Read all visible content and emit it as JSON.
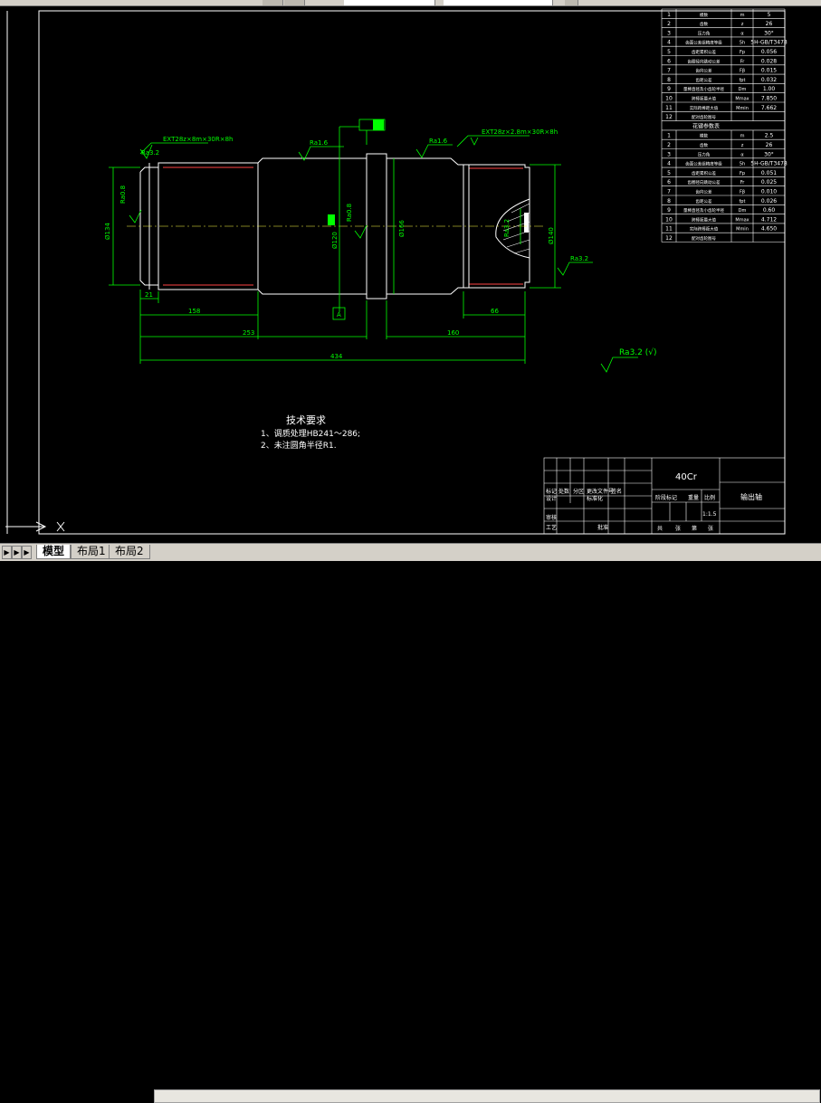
{
  "tabs": [
    {
      "label": "模型",
      "active": true
    },
    {
      "label": "布局1",
      "active": false
    },
    {
      "label": "布局2",
      "active": false
    }
  ],
  "drawing": {
    "thread_labels": [
      "EXT28z×8m×30R×8h",
      "EXT28z×2.8m×30R×8h"
    ],
    "roughness": [
      "Ra3.2",
      "Ra1.6",
      "Ra1.6",
      "Ra0.8",
      "Ra0.8",
      "Ra3.2",
      "Ra3.2"
    ],
    "diameters": [
      "Ø134",
      "Ø120",
      "Ø166",
      "Ø140"
    ],
    "dims": [
      "21",
      "158",
      "253",
      "434",
      "160",
      "66"
    ],
    "datum": "A",
    "finish_symbol": "Ra3.2 (√)",
    "tech_title": "技术要求",
    "tech_notes": [
      "1、调质处理HB241～286;",
      "2、未注圆角半径R1."
    ]
  },
  "param_table": {
    "rows": [
      [
        "1",
        "模数",
        "m",
        "5"
      ],
      [
        "2",
        "齿数",
        "z",
        "26"
      ],
      [
        "3",
        "压力角",
        "α",
        "30°"
      ],
      [
        "4",
        "齿面公差组精度等级",
        "5h",
        "5H-GB/T3478"
      ],
      [
        "5",
        "齿距累积公差",
        "Fp",
        "0.056"
      ],
      [
        "6",
        "齿圈径向跳动公差",
        "Fr",
        "0.028"
      ],
      [
        "7",
        "齿向公差",
        "Fβ",
        "0.015"
      ],
      [
        "8",
        "齿距公差",
        "fpt",
        "0.032"
      ],
      [
        "9",
        "量棒直径及小齿轮半径",
        "Dm",
        "1.00"
      ],
      [
        "10",
        "跨棒距最大值",
        "Mmax",
        "7.850"
      ],
      [
        "11",
        "实际跨棒距大值",
        "Mmin",
        "7.662"
      ],
      [
        "12",
        "配对齿轮图号",
        "",
        ""
      ]
    ],
    "section_header": "花键参数表",
    "rows2": [
      [
        "1",
        "模数",
        "m",
        "2.5"
      ],
      [
        "2",
        "齿数",
        "z",
        "26"
      ],
      [
        "3",
        "压力角",
        "α",
        "30°"
      ],
      [
        "4",
        "齿面公差组精度等级",
        "5h",
        "5H-GB/T3478"
      ],
      [
        "5",
        "齿距累积公差",
        "Fp",
        "0.051"
      ],
      [
        "6",
        "齿圈径向跳动公差",
        "Fr",
        "0.025"
      ],
      [
        "7",
        "齿向公差",
        "Fβ",
        "0.010"
      ],
      [
        "8",
        "齿距公差",
        "fpt",
        "0.026"
      ],
      [
        "9",
        "量棒直径及小齿轮半径",
        "Dm",
        "0.60"
      ],
      [
        "10",
        "跨棒距最大值",
        "Mmax",
        "4.712"
      ],
      [
        "11",
        "实际跨棒距大值",
        "Mmin",
        "4.650"
      ],
      [
        "12",
        "配对齿轮图号",
        "",
        ""
      ]
    ]
  },
  "title_block": {
    "material": "40Cr",
    "part_name": "输出轴",
    "scale": "1:1.5",
    "cells": [
      "标记",
      "处数",
      "分区",
      "更改文件号",
      "签名",
      "设计",
      "标准化",
      "审核",
      "工艺",
      "批准",
      "阶段标记",
      "重量",
      "比例",
      "共",
      "张",
      "第",
      "张"
    ]
  }
}
